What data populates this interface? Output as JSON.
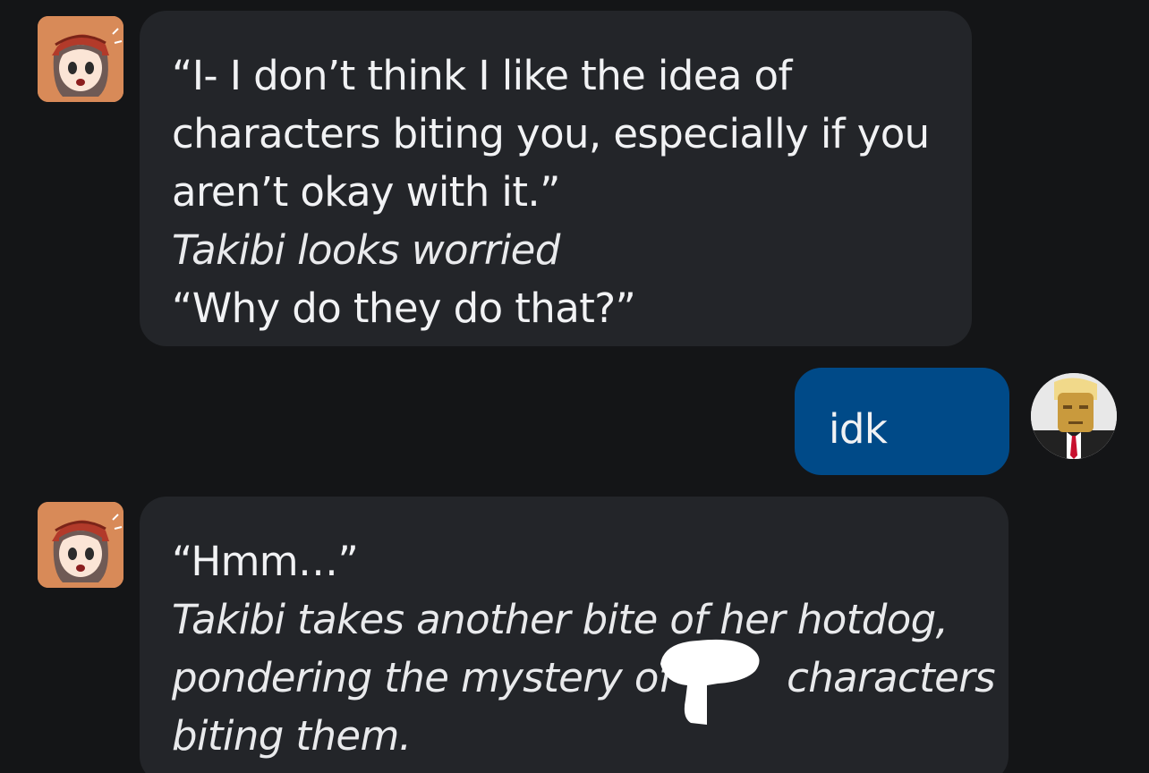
{
  "messages": [
    {
      "sender": "bot",
      "lines": [
        {
          "text": "“I- I don’t think I like the idea of",
          "style": "speech"
        },
        {
          "text": "characters biting you, especially if you",
          "style": "speech"
        },
        {
          "text": "aren’t okay with it.”",
          "style": "speech"
        },
        {
          "text": "Takibi looks worried",
          "style": "narration"
        },
        {
          "text": "“Why do they do that?”",
          "style": "speech"
        }
      ]
    },
    {
      "sender": "user",
      "text": "idk"
    },
    {
      "sender": "bot",
      "lines": [
        {
          "text": "“Hmm…”",
          "style": "speech"
        },
        {
          "text": "Takibi takes another bite of her hotdog,",
          "style": "narration"
        },
        {
          "text": "pondering the mystery of",
          "style": "narration"
        },
        {
          "text": "characters",
          "style": "narration"
        },
        {
          "text": "biting them.",
          "style": "narration"
        }
      ]
    }
  ],
  "colors": {
    "background": "#141517",
    "bot_bubble": "#232529",
    "user_bubble": "#004a88",
    "bot_avatar_bg": "#d88a58",
    "redaction": "#ffffff"
  },
  "icons": {
    "bot_avatar": "anime-girl-avatar",
    "user_avatar": "blocky-figure-avatar",
    "redaction": "white-scribble-redaction"
  }
}
